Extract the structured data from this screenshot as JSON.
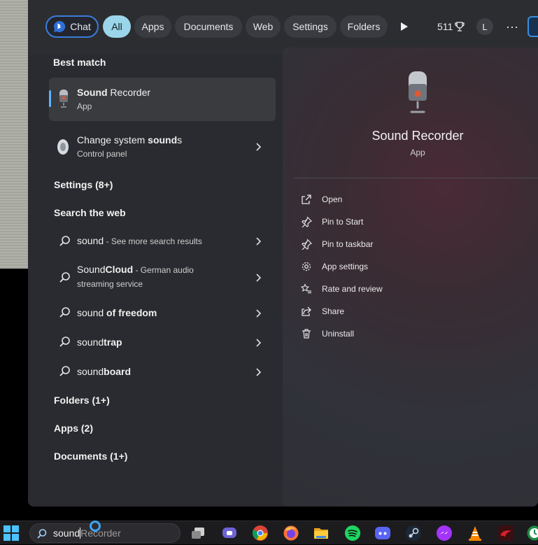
{
  "filters": {
    "chat": "Chat",
    "all": "All",
    "apps": "Apps",
    "documents": "Documents",
    "web": "Web",
    "settings": "Settings",
    "folders": "Folders"
  },
  "rewards": {
    "points": "511"
  },
  "profile": {
    "initial": "L"
  },
  "best_match": {
    "heading": "Best match",
    "title_bold": "Sound",
    "title_rest": " Recorder",
    "subtitle": "App"
  },
  "system_sounds": {
    "title_pre": "Change system ",
    "title_bold": "sound",
    "title_post": "s",
    "subtitle": "Control panel"
  },
  "settings_heading": "Settings (8+)",
  "web_heading": "Search the web",
  "web_results": [
    {
      "typed": "sound",
      "suggest": "",
      "extra": " - See more search results"
    },
    {
      "typed": "Sound",
      "suggest": "Cloud",
      "extra": " - German audio",
      "extra2": "streaming service"
    },
    {
      "typed": "sound",
      "suggest": " of freedom",
      "extra": ""
    },
    {
      "typed": "sound",
      "suggest": "trap",
      "extra": ""
    },
    {
      "typed": "sound",
      "suggest": "board",
      "extra": ""
    }
  ],
  "folders_heading": "Folders (1+)",
  "apps_heading": "Apps (2)",
  "documents_heading": "Documents (1+)",
  "preview": {
    "title": "Sound Recorder",
    "subtitle": "App",
    "actions": [
      "Open",
      "Pin to Start",
      "Pin to taskbar",
      "App settings",
      "Rate and review",
      "Share",
      "Uninstall"
    ]
  },
  "taskbar": {
    "search_typed": "sound",
    "search_ghost": "Recorder"
  }
}
